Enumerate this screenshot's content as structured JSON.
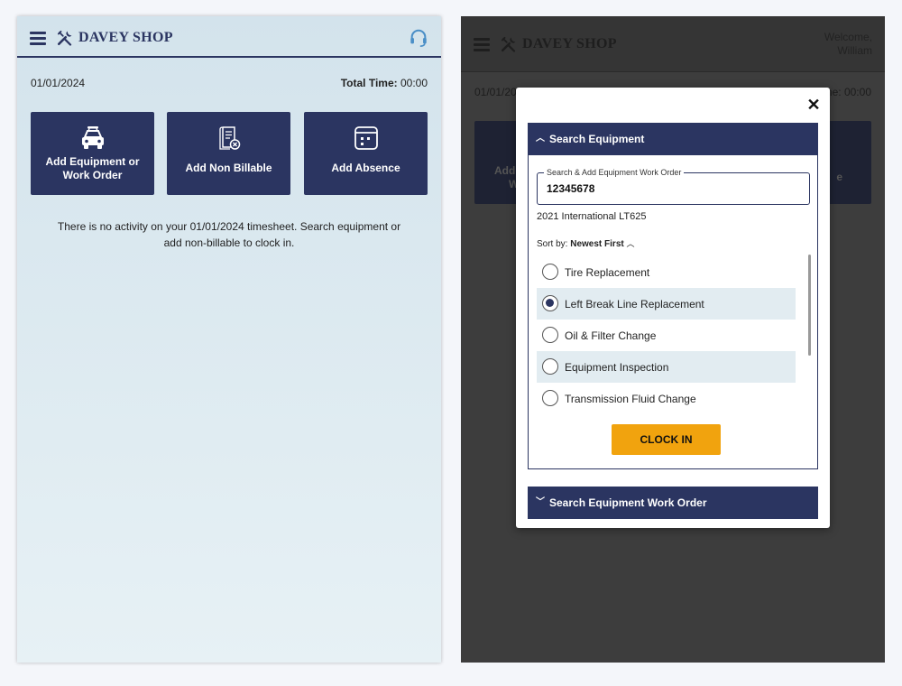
{
  "app": {
    "brand": "DAVEY SHOP"
  },
  "left": {
    "date": "01/01/2024",
    "total_label": "Total Time:",
    "total_value": "00:00",
    "tiles": [
      {
        "label": "Add Equipment or Work Order",
        "icon": "car-icon"
      },
      {
        "label": "Add Non Billable",
        "icon": "document-cancel-icon"
      },
      {
        "label": "Add Absence",
        "icon": "calendar-icon"
      }
    ],
    "empty_message": "There is no activity on your 01/01/2024 timesheet. Search equipment or add non-billable to clock in."
  },
  "right": {
    "welcome_line1": "Welcome,",
    "welcome_line2": "William",
    "date_partial": "01/01/20",
    "total_partial": "me: 00:00",
    "tile_fragments": [
      "Add",
      "W",
      "e"
    ]
  },
  "modal": {
    "section1_title": "Search Equipment",
    "field_label": "Search & Add Equipment Work Order",
    "field_value": "12345678",
    "equipment_name": "2021 International LT625",
    "sort_label": "Sort by:",
    "sort_value": "Newest First",
    "options": [
      {
        "label": "Tire Replacement",
        "selected": false
      },
      {
        "label": "Left Break Line Replacement",
        "selected": true
      },
      {
        "label": "Oil & Filter Change",
        "selected": false
      },
      {
        "label": "Equipment Inspection",
        "selected": false
      },
      {
        "label": "Transmission Fluid Change",
        "selected": false
      }
    ],
    "clock_in_label": "CLOCK IN",
    "section2_title": "Search Equipment Work Order"
  },
  "colors": {
    "navy": "#2b3561",
    "accent": "#f1a30e",
    "overlay": "#3d3d3d"
  }
}
